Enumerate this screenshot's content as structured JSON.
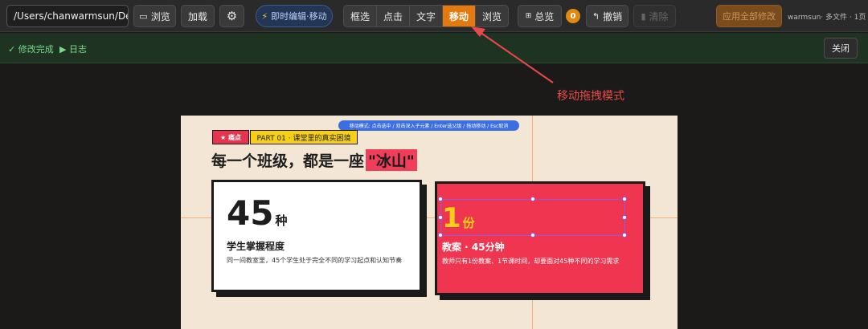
{
  "toolbar": {
    "path_value": "/Users/chanwarmsun/Desktop",
    "browse_label": "浏览",
    "load_label": "加载",
    "live_edit_label": "即时编辑·移动",
    "modes": [
      {
        "label": "框选"
      },
      {
        "label": "点击"
      },
      {
        "label": "文字"
      },
      {
        "label": "移动"
      },
      {
        "label": "浏览"
      }
    ],
    "active_mode": "移动",
    "overview_label": "总览",
    "change_count": "0",
    "undo_label": "撤销",
    "clear_label": "清除",
    "apply_all_label": "应用全部修改",
    "status_text": "warmsun· 多文件 · 1页",
    "accent_color": "#e6790e"
  },
  "subbar": {
    "done_text": "✓ 修改完成",
    "log_label": "▶ 日志",
    "close_label": "关闭"
  },
  "annotation": {
    "label": "移动拖拽模式",
    "color": "#e84a4a"
  },
  "slide": {
    "hint": "移动模式: 点击选中 / 双击深入子元素 / Enter选父级 / 拖动移动 / Esc取消",
    "tag_red": "★ 痛点",
    "tag_yellow": "PART 01 · 课堂里的真实困境",
    "title_main": "每一个班级，都是一座",
    "title_highlight": "\"冰山\"",
    "card1": {
      "number": "45",
      "unit": "种",
      "subtitle": "学生掌握程度",
      "desc": "同一间教室里，45个学生处于完全不同的学习起点和认知节奏"
    },
    "card2": {
      "number": "1",
      "unit": "份",
      "subtitle": "教案 · 45分钟",
      "desc": "教师只有1份教案、1节课时间，却要面对45种不同的学习需求"
    },
    "colors": {
      "background": "#f4e6d4",
      "red": "#f03550",
      "yellow": "#f7cf17",
      "number_yellow": "#f7cf17"
    }
  },
  "icons": {
    "browse": "folder-icon",
    "settings": "gear-icon",
    "live_edit": "lightning-icon",
    "overview": "grid-icon",
    "undo": "undo-icon",
    "clear": "trash-icon"
  }
}
